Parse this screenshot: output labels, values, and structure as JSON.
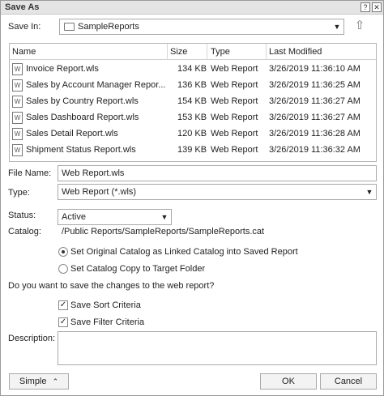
{
  "window": {
    "title": "Save As",
    "help_glyph": "?",
    "close_glyph": "✕"
  },
  "save_in": {
    "label": "Save In:",
    "value": "SampleReports"
  },
  "files": {
    "columns": [
      "Name",
      "Size",
      "Type",
      "Last Modified"
    ],
    "rows": [
      {
        "name": "Invoice Report.wls",
        "size": "134 KB",
        "type": "Web Report",
        "modified": "3/26/2019 11:36:10 AM"
      },
      {
        "name": "Sales by Account Manager Repor...",
        "size": "136 KB",
        "type": "Web Report",
        "modified": "3/26/2019 11:36:25 AM"
      },
      {
        "name": "Sales by Country Report.wls",
        "size": "154 KB",
        "type": "Web Report",
        "modified": "3/26/2019 11:36:27 AM"
      },
      {
        "name": "Sales Dashboard Report.wls",
        "size": "153 KB",
        "type": "Web Report",
        "modified": "3/26/2019 11:36:27 AM"
      },
      {
        "name": "Sales Detail Report.wls",
        "size": "120 KB",
        "type": "Web Report",
        "modified": "3/26/2019 11:36:28 AM"
      },
      {
        "name": "Shipment Status Report.wls",
        "size": "139 KB",
        "type": "Web Report",
        "modified": "3/26/2019 11:36:32 AM"
      }
    ]
  },
  "file_name": {
    "label": "File Name:",
    "value": "Web Report.wls"
  },
  "type": {
    "label": "Type:",
    "value": "Web Report (*.wls)"
  },
  "status": {
    "label": "Status:",
    "value": "Active"
  },
  "catalog": {
    "label": "Catalog:",
    "path": "/Public Reports/SampleReports/SampleReports.cat",
    "option_linked": "Set Original Catalog as Linked Catalog into Saved Report",
    "option_copy": "Set Catalog Copy to Target Folder"
  },
  "question": "Do you want to save the changes to the web report?",
  "save_sort": "Save Sort Criteria",
  "save_filter": "Save Filter Criteria",
  "description": {
    "label": "Description:",
    "value": ""
  },
  "buttons": {
    "simple": "Simple",
    "ok": "OK",
    "cancel": "Cancel"
  }
}
